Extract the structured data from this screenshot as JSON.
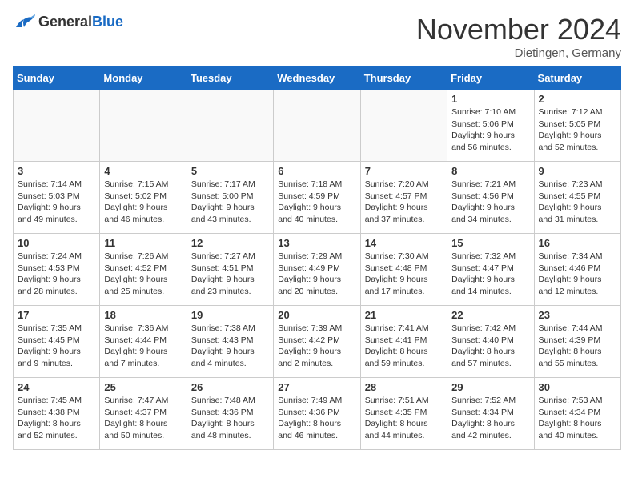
{
  "header": {
    "logo_general": "General",
    "logo_blue": "Blue",
    "title": "November 2024",
    "location": "Dietingen, Germany"
  },
  "weekdays": [
    "Sunday",
    "Monday",
    "Tuesday",
    "Wednesday",
    "Thursday",
    "Friday",
    "Saturday"
  ],
  "weeks": [
    [
      {
        "day": "",
        "info": "",
        "shaded": true
      },
      {
        "day": "",
        "info": "",
        "shaded": true
      },
      {
        "day": "",
        "info": "",
        "shaded": true
      },
      {
        "day": "",
        "info": "",
        "shaded": true
      },
      {
        "day": "",
        "info": "",
        "shaded": true
      },
      {
        "day": "1",
        "info": "Sunrise: 7:10 AM\nSunset: 5:06 PM\nDaylight: 9 hours\nand 56 minutes.",
        "shaded": false
      },
      {
        "day": "2",
        "info": "Sunrise: 7:12 AM\nSunset: 5:05 PM\nDaylight: 9 hours\nand 52 minutes.",
        "shaded": false
      }
    ],
    [
      {
        "day": "3",
        "info": "Sunrise: 7:14 AM\nSunset: 5:03 PM\nDaylight: 9 hours\nand 49 minutes.",
        "shaded": false
      },
      {
        "day": "4",
        "info": "Sunrise: 7:15 AM\nSunset: 5:02 PM\nDaylight: 9 hours\nand 46 minutes.",
        "shaded": false
      },
      {
        "day": "5",
        "info": "Sunrise: 7:17 AM\nSunset: 5:00 PM\nDaylight: 9 hours\nand 43 minutes.",
        "shaded": false
      },
      {
        "day": "6",
        "info": "Sunrise: 7:18 AM\nSunset: 4:59 PM\nDaylight: 9 hours\nand 40 minutes.",
        "shaded": false
      },
      {
        "day": "7",
        "info": "Sunrise: 7:20 AM\nSunset: 4:57 PM\nDaylight: 9 hours\nand 37 minutes.",
        "shaded": false
      },
      {
        "day": "8",
        "info": "Sunrise: 7:21 AM\nSunset: 4:56 PM\nDaylight: 9 hours\nand 34 minutes.",
        "shaded": false
      },
      {
        "day": "9",
        "info": "Sunrise: 7:23 AM\nSunset: 4:55 PM\nDaylight: 9 hours\nand 31 minutes.",
        "shaded": false
      }
    ],
    [
      {
        "day": "10",
        "info": "Sunrise: 7:24 AM\nSunset: 4:53 PM\nDaylight: 9 hours\nand 28 minutes.",
        "shaded": false
      },
      {
        "day": "11",
        "info": "Sunrise: 7:26 AM\nSunset: 4:52 PM\nDaylight: 9 hours\nand 25 minutes.",
        "shaded": false
      },
      {
        "day": "12",
        "info": "Sunrise: 7:27 AM\nSunset: 4:51 PM\nDaylight: 9 hours\nand 23 minutes.",
        "shaded": false
      },
      {
        "day": "13",
        "info": "Sunrise: 7:29 AM\nSunset: 4:49 PM\nDaylight: 9 hours\nand 20 minutes.",
        "shaded": false
      },
      {
        "day": "14",
        "info": "Sunrise: 7:30 AM\nSunset: 4:48 PM\nDaylight: 9 hours\nand 17 minutes.",
        "shaded": false
      },
      {
        "day": "15",
        "info": "Sunrise: 7:32 AM\nSunset: 4:47 PM\nDaylight: 9 hours\nand 14 minutes.",
        "shaded": false
      },
      {
        "day": "16",
        "info": "Sunrise: 7:34 AM\nSunset: 4:46 PM\nDaylight: 9 hours\nand 12 minutes.",
        "shaded": false
      }
    ],
    [
      {
        "day": "17",
        "info": "Sunrise: 7:35 AM\nSunset: 4:45 PM\nDaylight: 9 hours\nand 9 minutes.",
        "shaded": false
      },
      {
        "day": "18",
        "info": "Sunrise: 7:36 AM\nSunset: 4:44 PM\nDaylight: 9 hours\nand 7 minutes.",
        "shaded": false
      },
      {
        "day": "19",
        "info": "Sunrise: 7:38 AM\nSunset: 4:43 PM\nDaylight: 9 hours\nand 4 minutes.",
        "shaded": false
      },
      {
        "day": "20",
        "info": "Sunrise: 7:39 AM\nSunset: 4:42 PM\nDaylight: 9 hours\nand 2 minutes.",
        "shaded": false
      },
      {
        "day": "21",
        "info": "Sunrise: 7:41 AM\nSunset: 4:41 PM\nDaylight: 8 hours\nand 59 minutes.",
        "shaded": false
      },
      {
        "day": "22",
        "info": "Sunrise: 7:42 AM\nSunset: 4:40 PM\nDaylight: 8 hours\nand 57 minutes.",
        "shaded": false
      },
      {
        "day": "23",
        "info": "Sunrise: 7:44 AM\nSunset: 4:39 PM\nDaylight: 8 hours\nand 55 minutes.",
        "shaded": false
      }
    ],
    [
      {
        "day": "24",
        "info": "Sunrise: 7:45 AM\nSunset: 4:38 PM\nDaylight: 8 hours\nand 52 minutes.",
        "shaded": false
      },
      {
        "day": "25",
        "info": "Sunrise: 7:47 AM\nSunset: 4:37 PM\nDaylight: 8 hours\nand 50 minutes.",
        "shaded": false
      },
      {
        "day": "26",
        "info": "Sunrise: 7:48 AM\nSunset: 4:36 PM\nDaylight: 8 hours\nand 48 minutes.",
        "shaded": false
      },
      {
        "day": "27",
        "info": "Sunrise: 7:49 AM\nSunset: 4:36 PM\nDaylight: 8 hours\nand 46 minutes.",
        "shaded": false
      },
      {
        "day": "28",
        "info": "Sunrise: 7:51 AM\nSunset: 4:35 PM\nDaylight: 8 hours\nand 44 minutes.",
        "shaded": false
      },
      {
        "day": "29",
        "info": "Sunrise: 7:52 AM\nSunset: 4:34 PM\nDaylight: 8 hours\nand 42 minutes.",
        "shaded": false
      },
      {
        "day": "30",
        "info": "Sunrise: 7:53 AM\nSunset: 4:34 PM\nDaylight: 8 hours\nand 40 minutes.",
        "shaded": false
      }
    ]
  ]
}
